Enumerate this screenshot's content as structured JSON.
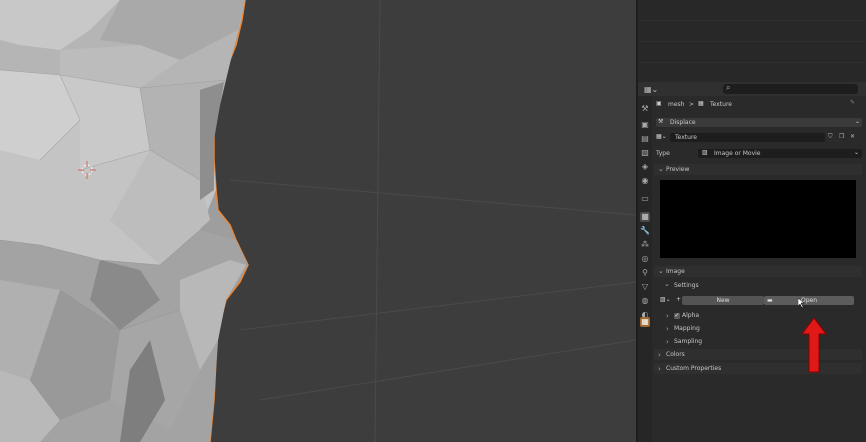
{
  "colors": {
    "accent_texture_tab": "#a06b33",
    "selection_outline": "#e8873a",
    "arrow": "#e01818"
  },
  "viewport": {
    "cursor_icon": "3d-cursor-icon"
  },
  "properties": {
    "search_placeholder": "⌕",
    "breadcrumb": {
      "object": "mesh",
      "separator": ">",
      "texture": "Texture"
    },
    "modifier_name": "Displace",
    "texture_name": "Texture",
    "type_label": "Type",
    "type_value": "Image or Movie",
    "panels": {
      "preview": "Preview",
      "image": "Image",
      "settings": "Settings",
      "new_button": "New",
      "open_button": "Open",
      "alpha": "Alpha",
      "mapping": "Mapping",
      "sampling": "Sampling",
      "colors": "Colors",
      "custom_properties": "Custom Properties"
    }
  }
}
